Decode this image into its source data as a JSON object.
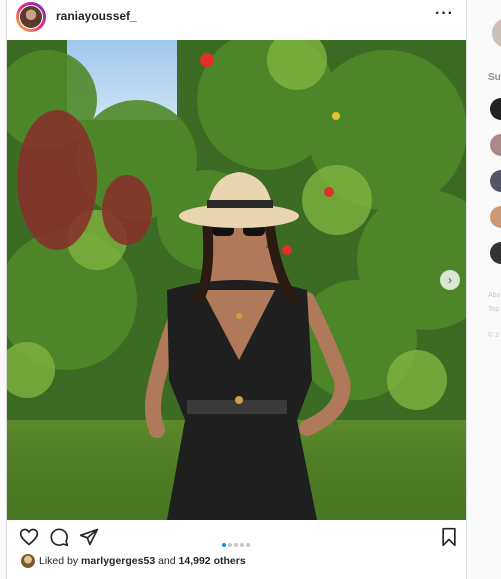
{
  "post": {
    "username": "raniayoussef_",
    "more_label": "···",
    "next_label": "›",
    "carousel": {
      "count": 5,
      "active_index": 0
    },
    "likes": {
      "prefix": "Liked by ",
      "user": "marlygerges53",
      "middle": " and ",
      "others": "14,992 others"
    }
  },
  "sidebar": {
    "suggestions_label": "Su",
    "footer_lines": [
      "Abo",
      "Top",
      "© 2"
    ]
  },
  "colors": {
    "like_active": "#0095f6",
    "text": "#262626",
    "muted": "#8e8e8e"
  },
  "icons": [
    "more-icon",
    "heart-icon",
    "comment-icon",
    "share-icon",
    "bookmark-icon",
    "chevron-right-icon"
  ]
}
